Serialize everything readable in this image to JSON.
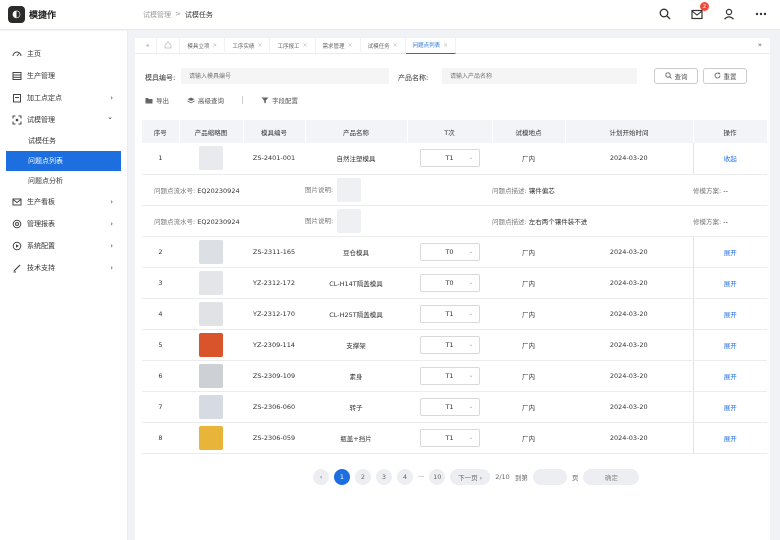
{
  "app": {
    "name": "模捷作",
    "logo_glyph": "◐"
  },
  "breadcrumb": {
    "parent": "试模管理",
    "separator": ">",
    "current": "试模任务"
  },
  "header": {
    "notification_count": "2"
  },
  "sidebar": {
    "items": [
      {
        "label": "主页",
        "icon": "gauge-icon"
      },
      {
        "label": "生产管理",
        "icon": "list-icon"
      },
      {
        "label": "加工点定点",
        "icon": "clipboard-icon",
        "chevron": "›"
      },
      {
        "label": "试模管理",
        "icon": "expand-icon",
        "chevron": "⌄"
      }
    ],
    "sub_items": [
      {
        "label": "试模任务"
      },
      {
        "label": "问题点列表"
      },
      {
        "label": "问题点分析"
      }
    ],
    "items_after": [
      {
        "label": "生产看板",
        "icon": "mail-icon",
        "chevron": "›"
      },
      {
        "label": "管理报表",
        "icon": "target-icon",
        "chevron": "›"
      },
      {
        "label": "系统配置",
        "icon": "play-circle-icon",
        "chevron": "›"
      },
      {
        "label": "技术支持",
        "icon": "pen-icon",
        "chevron": "›"
      }
    ]
  },
  "tabs": {
    "left_arrow": "«",
    "right_arrow": "»",
    "items": [
      {
        "label": "模具立项"
      },
      {
        "label": "工序实绩"
      },
      {
        "label": "工序报工"
      },
      {
        "label": "需求管理"
      },
      {
        "label": "试模任务"
      },
      {
        "label": "问题点列表"
      }
    ]
  },
  "filters": {
    "mold_label": "模具编号:",
    "mold_placeholder": "请输入模具编号",
    "product_label": "产品名称:",
    "product_placeholder": "请输入产品名称",
    "search_label": "查询",
    "reset_label": "重置"
  },
  "toolbar": {
    "export": "导出",
    "advanced": "高级查询",
    "columns": "字段配置"
  },
  "table": {
    "headers": [
      "序号",
      "产品缩略图",
      "模具编号",
      "产品名称",
      "T次",
      "试模地点",
      "计划开始时间",
      "操作"
    ],
    "rows": [
      {
        "no": "1",
        "thumb_color": "#e9eaee",
        "mold": "ZS-2401-001",
        "product": "自然注塑模具",
        "t": "T1",
        "place": "厂内",
        "date": "2024-03-20",
        "op": "收起",
        "details": [
          {
            "flow_label": "问题点流水号:",
            "flow": "EQ20230924",
            "pic_label": "图片说明:",
            "desc_label": "问题点描述:",
            "desc": "镶件偏芯",
            "plan_label": "修模方案:",
            "plan": "--"
          },
          {
            "flow_label": "问题点流水号:",
            "flow": "EQ20230924",
            "pic_label": "图片说明:",
            "desc_label": "问题点描述:",
            "desc": "左右两个镶件装不进",
            "plan_label": "修模方案:",
            "plan": "--"
          }
        ]
      },
      {
        "no": "2",
        "thumb_color": "#dcdfe4",
        "mold": "ZS-2311-165",
        "product": "豆仓模具",
        "t": "T0",
        "place": "厂内",
        "date": "2024-03-20",
        "op": "展开"
      },
      {
        "no": "3",
        "thumb_color": "#e3e5e8",
        "mold": "YZ-2312-172",
        "product": "CL-H14T隔盖模具",
        "t": "T0",
        "place": "厂内",
        "date": "2024-03-20",
        "op": "展开"
      },
      {
        "no": "4",
        "thumb_color": "#e0e2e6",
        "mold": "YZ-2312-170",
        "product": "CL-H25T隔盖模具",
        "t": "T1",
        "place": "厂内",
        "date": "2024-03-20",
        "op": "展开"
      },
      {
        "no": "5",
        "thumb_color": "#d9532b",
        "mold": "YZ-2309-114",
        "product": "支撑架",
        "t": "T1",
        "place": "厂内",
        "date": "2024-03-20",
        "op": "展开"
      },
      {
        "no": "6",
        "thumb_color": "#cdd0d5",
        "mold": "ZS-2309-109",
        "product": "素身",
        "t": "T1",
        "place": "厂内",
        "date": "2024-03-20",
        "op": "展开"
      },
      {
        "no": "7",
        "thumb_color": "#d6dbe3",
        "mold": "ZS-2306-060",
        "product": "转子",
        "t": "T1",
        "place": "厂内",
        "date": "2024-03-20",
        "op": "展开"
      },
      {
        "no": "8",
        "thumb_color": "#e8b43a",
        "mold": "ZS-2306-059",
        "product": "瓶盖+挡片",
        "t": "T1",
        "place": "厂内",
        "date": "2024-03-20",
        "op": "展开"
      }
    ]
  },
  "pagination": {
    "prev": "‹",
    "pages": [
      "1",
      "2",
      "3",
      "4",
      "···",
      "10"
    ],
    "next": "下一页 ›",
    "total": "2/10",
    "goto": "到第",
    "page_unit": "页",
    "confirm": "确定"
  }
}
